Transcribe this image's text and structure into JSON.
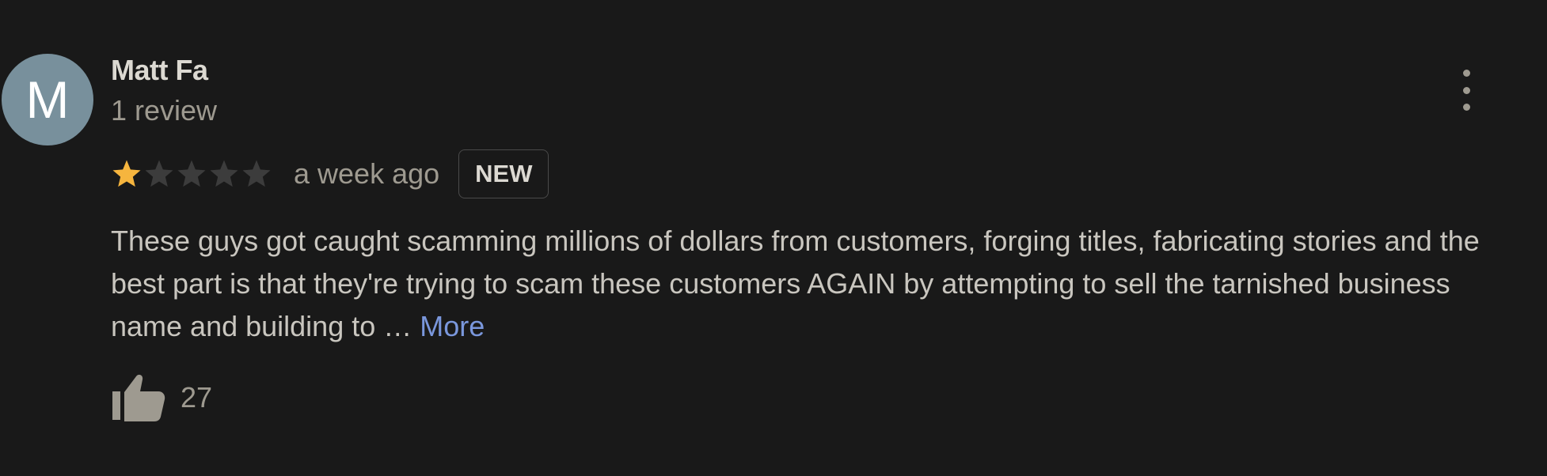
{
  "review": {
    "avatar_initial": "M",
    "author_name": "Matt Fa",
    "review_count": "1 review",
    "rating": 1,
    "rating_max": 5,
    "time_ago": "a week ago",
    "badge": "NEW",
    "text": "These guys got caught scamming millions of dollars from customers, forging titles, fabricating stories and the best part is that they're trying to scam these customers AGAIN by attempting to sell the tarnished business name and building to … ",
    "more_label": "More",
    "like_count": "27"
  },
  "colors": {
    "background": "#191919",
    "avatar": "#78909c",
    "star_filled": "#f6b53e",
    "star_empty": "#3c3c3c",
    "link": "#7a97dc"
  },
  "icons": {
    "menu": "more-vert-icon",
    "star": "star-icon",
    "like": "thumb-up-icon"
  }
}
